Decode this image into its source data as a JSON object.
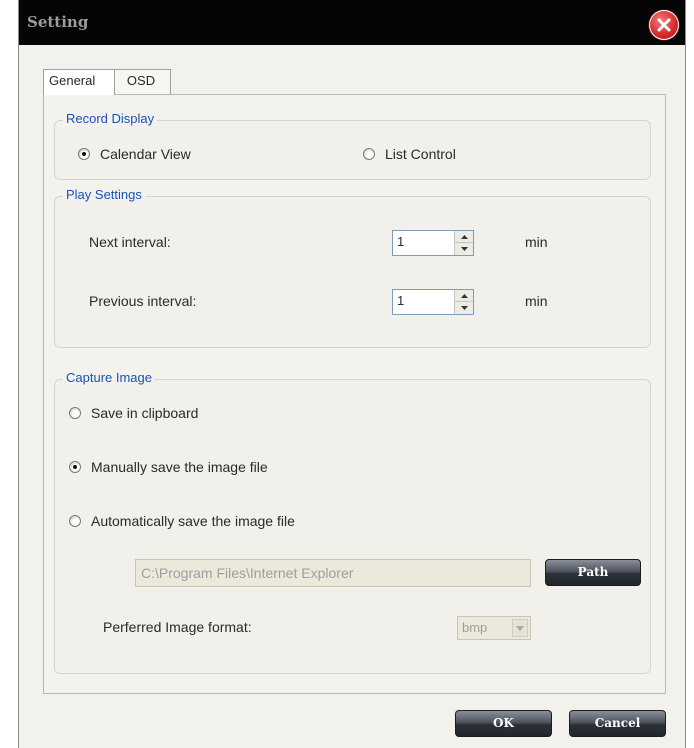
{
  "window": {
    "title": "Setting"
  },
  "tabs": [
    {
      "label": "General",
      "active": true
    },
    {
      "label": "OSD",
      "active": false
    }
  ],
  "record_display": {
    "legend": "Record Display",
    "options": [
      {
        "label": "Calendar View",
        "checked": true
      },
      {
        "label": "List Control",
        "checked": false
      }
    ]
  },
  "play_settings": {
    "legend": "Play Settings",
    "next_label": "Next interval:",
    "next_value": "1",
    "previous_label": "Previous interval:",
    "previous_value": "1",
    "unit": "min"
  },
  "capture_image": {
    "legend": "Capture Image",
    "options": [
      {
        "label": "Save in clipboard",
        "checked": false
      },
      {
        "label": "Manually save the image file",
        "checked": true
      },
      {
        "label": "Automatically save the image file",
        "checked": false
      }
    ],
    "path_value": "C:\\Program Files\\Internet Explorer",
    "path_button": "Path",
    "format_label": "Perferred Image format:",
    "format_value": "bmp"
  },
  "footer": {
    "ok_label": "OK",
    "cancel_label": "Cancel"
  },
  "colors": {
    "accent_legend": "#1a52b8",
    "close": "#d82a2a",
    "titlebar": "#050505"
  },
  "icons": {
    "close": "close-icon",
    "spin_up": "chevron-up-icon",
    "spin_down": "chevron-down-icon",
    "dropdown": "chevron-down-icon"
  }
}
